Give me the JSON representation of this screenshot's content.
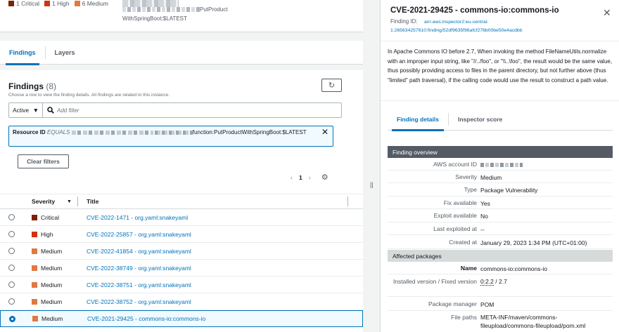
{
  "summary": {
    "critical": "1 Critical",
    "high": "1 High",
    "medium": "6 Medium"
  },
  "resource": {
    "name_part1": "PutProduct",
    "name_part2": "WithSpringBoot:$LATEST"
  },
  "tabs": [
    "Findings",
    "Layers"
  ],
  "findings": {
    "title": "Findings",
    "count": "(8)",
    "description": "Choose a row to view the finding details. All findings are related to this instance.",
    "filter_status": "Active",
    "filter_placeholder": "Add filter",
    "token_key": "Resource ID",
    "token_op": "EQUALS",
    "token_value": "function:PutProductWithSpringBoot:$LATEST",
    "clear_filters": "Clear filters",
    "page": "1",
    "columns": {
      "severity": "Severity",
      "title": "Title"
    },
    "rows": [
      {
        "severity": "Critical",
        "color": "#7d2105",
        "title": "CVE-2022-1471 - org.yaml:snakeyaml"
      },
      {
        "severity": "High",
        "color": "#d13212",
        "title": "CVE-2022-25857 - org.yaml:snakeyaml"
      },
      {
        "severity": "Medium",
        "color": "#e07941",
        "title": "CVE-2022-41854 - org.yaml:snakeyaml"
      },
      {
        "severity": "Medium",
        "color": "#e07941",
        "title": "CVE-2022-38749 - org.yaml:snakeyaml"
      },
      {
        "severity": "Medium",
        "color": "#e07941",
        "title": "CVE-2022-38751 - org.yaml:snakeyaml"
      },
      {
        "severity": "Medium",
        "color": "#e07941",
        "title": "CVE-2022-38752 - org.yaml:snakeyaml"
      },
      {
        "severity": "Medium",
        "color": "#e07941",
        "title": "CVE-2021-29425 - commons-io:commons-io"
      }
    ]
  },
  "detail": {
    "title": "CVE-2021-29425 - commons-io:commons-io",
    "finding_id_label": "Finding ID:",
    "finding_id": "arn:aws:inspector2:eu-central-1:265634257610:finding/52df9635f96afcf276b00be50e4acdbb",
    "description": "In Apache Commons IO before 2.7, When invoking the method FileNameUtils.normalize with an improper input string, like \"//../foo\", or \"\\\\..\\foo\", the result would be the same value, thus possibly providing access to files in the parent directory, but not further above (thus \"limited\" path traversal), if the calling code would use the result to construct a path value.",
    "tabs": [
      "Finding details",
      "Inspector score"
    ],
    "overview_header": "Finding overview",
    "overview": {
      "aws_account_id": "AWS account ID",
      "severity_label": "Severity",
      "severity": "Medium",
      "type_label": "Type",
      "type": "Package Vulnerability",
      "fix_label": "Fix available",
      "fix": "Yes",
      "exploit_label": "Exploit available",
      "exploit": "No",
      "last_exploited_label": "Last exploited at",
      "last_exploited": "--",
      "created_label": "Created at",
      "created": "January 29, 2023 1:34 PM (UTC+01:00)"
    },
    "affected_header": "Affected packages",
    "packages": {
      "name_label": "Name",
      "name": "commons-io:commons-io",
      "version_label": "Installed version / Fixed version",
      "installed": "0:2.2",
      "fixed": " / 2.7",
      "manager_label": "Package manager",
      "manager": "POM",
      "paths_label": "File paths",
      "paths": "META-INF/maven/commons-fileupload/commons-fileupload/pom.xml"
    }
  }
}
